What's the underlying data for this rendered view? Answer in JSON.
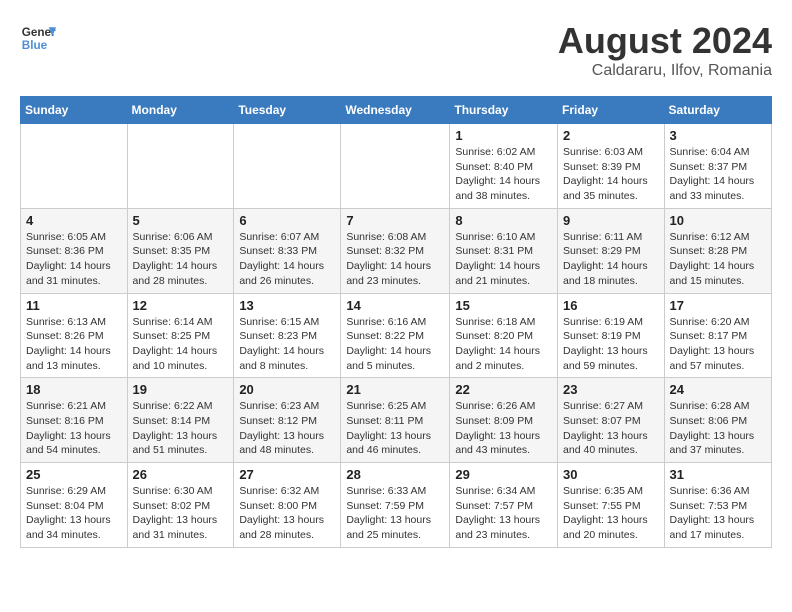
{
  "header": {
    "logo_general": "General",
    "logo_blue": "Blue",
    "month_year": "August 2024",
    "location": "Caldararu, Ilfov, Romania"
  },
  "weekdays": [
    "Sunday",
    "Monday",
    "Tuesday",
    "Wednesday",
    "Thursday",
    "Friday",
    "Saturday"
  ],
  "weeks": [
    [
      {
        "day": "",
        "info": ""
      },
      {
        "day": "",
        "info": ""
      },
      {
        "day": "",
        "info": ""
      },
      {
        "day": "",
        "info": ""
      },
      {
        "day": "1",
        "info": "Sunrise: 6:02 AM\nSunset: 8:40 PM\nDaylight: 14 hours\nand 38 minutes."
      },
      {
        "day": "2",
        "info": "Sunrise: 6:03 AM\nSunset: 8:39 PM\nDaylight: 14 hours\nand 35 minutes."
      },
      {
        "day": "3",
        "info": "Sunrise: 6:04 AM\nSunset: 8:37 PM\nDaylight: 14 hours\nand 33 minutes."
      }
    ],
    [
      {
        "day": "4",
        "info": "Sunrise: 6:05 AM\nSunset: 8:36 PM\nDaylight: 14 hours\nand 31 minutes."
      },
      {
        "day": "5",
        "info": "Sunrise: 6:06 AM\nSunset: 8:35 PM\nDaylight: 14 hours\nand 28 minutes."
      },
      {
        "day": "6",
        "info": "Sunrise: 6:07 AM\nSunset: 8:33 PM\nDaylight: 14 hours\nand 26 minutes."
      },
      {
        "day": "7",
        "info": "Sunrise: 6:08 AM\nSunset: 8:32 PM\nDaylight: 14 hours\nand 23 minutes."
      },
      {
        "day": "8",
        "info": "Sunrise: 6:10 AM\nSunset: 8:31 PM\nDaylight: 14 hours\nand 21 minutes."
      },
      {
        "day": "9",
        "info": "Sunrise: 6:11 AM\nSunset: 8:29 PM\nDaylight: 14 hours\nand 18 minutes."
      },
      {
        "day": "10",
        "info": "Sunrise: 6:12 AM\nSunset: 8:28 PM\nDaylight: 14 hours\nand 15 minutes."
      }
    ],
    [
      {
        "day": "11",
        "info": "Sunrise: 6:13 AM\nSunset: 8:26 PM\nDaylight: 14 hours\nand 13 minutes."
      },
      {
        "day": "12",
        "info": "Sunrise: 6:14 AM\nSunset: 8:25 PM\nDaylight: 14 hours\nand 10 minutes."
      },
      {
        "day": "13",
        "info": "Sunrise: 6:15 AM\nSunset: 8:23 PM\nDaylight: 14 hours\nand 8 minutes."
      },
      {
        "day": "14",
        "info": "Sunrise: 6:16 AM\nSunset: 8:22 PM\nDaylight: 14 hours\nand 5 minutes."
      },
      {
        "day": "15",
        "info": "Sunrise: 6:18 AM\nSunset: 8:20 PM\nDaylight: 14 hours\nand 2 minutes."
      },
      {
        "day": "16",
        "info": "Sunrise: 6:19 AM\nSunset: 8:19 PM\nDaylight: 13 hours\nand 59 minutes."
      },
      {
        "day": "17",
        "info": "Sunrise: 6:20 AM\nSunset: 8:17 PM\nDaylight: 13 hours\nand 57 minutes."
      }
    ],
    [
      {
        "day": "18",
        "info": "Sunrise: 6:21 AM\nSunset: 8:16 PM\nDaylight: 13 hours\nand 54 minutes."
      },
      {
        "day": "19",
        "info": "Sunrise: 6:22 AM\nSunset: 8:14 PM\nDaylight: 13 hours\nand 51 minutes."
      },
      {
        "day": "20",
        "info": "Sunrise: 6:23 AM\nSunset: 8:12 PM\nDaylight: 13 hours\nand 48 minutes."
      },
      {
        "day": "21",
        "info": "Sunrise: 6:25 AM\nSunset: 8:11 PM\nDaylight: 13 hours\nand 46 minutes."
      },
      {
        "day": "22",
        "info": "Sunrise: 6:26 AM\nSunset: 8:09 PM\nDaylight: 13 hours\nand 43 minutes."
      },
      {
        "day": "23",
        "info": "Sunrise: 6:27 AM\nSunset: 8:07 PM\nDaylight: 13 hours\nand 40 minutes."
      },
      {
        "day": "24",
        "info": "Sunrise: 6:28 AM\nSunset: 8:06 PM\nDaylight: 13 hours\nand 37 minutes."
      }
    ],
    [
      {
        "day": "25",
        "info": "Sunrise: 6:29 AM\nSunset: 8:04 PM\nDaylight: 13 hours\nand 34 minutes."
      },
      {
        "day": "26",
        "info": "Sunrise: 6:30 AM\nSunset: 8:02 PM\nDaylight: 13 hours\nand 31 minutes."
      },
      {
        "day": "27",
        "info": "Sunrise: 6:32 AM\nSunset: 8:00 PM\nDaylight: 13 hours\nand 28 minutes."
      },
      {
        "day": "28",
        "info": "Sunrise: 6:33 AM\nSunset: 7:59 PM\nDaylight: 13 hours\nand 25 minutes."
      },
      {
        "day": "29",
        "info": "Sunrise: 6:34 AM\nSunset: 7:57 PM\nDaylight: 13 hours\nand 23 minutes."
      },
      {
        "day": "30",
        "info": "Sunrise: 6:35 AM\nSunset: 7:55 PM\nDaylight: 13 hours\nand 20 minutes."
      },
      {
        "day": "31",
        "info": "Sunrise: 6:36 AM\nSunset: 7:53 PM\nDaylight: 13 hours\nand 17 minutes."
      }
    ]
  ]
}
